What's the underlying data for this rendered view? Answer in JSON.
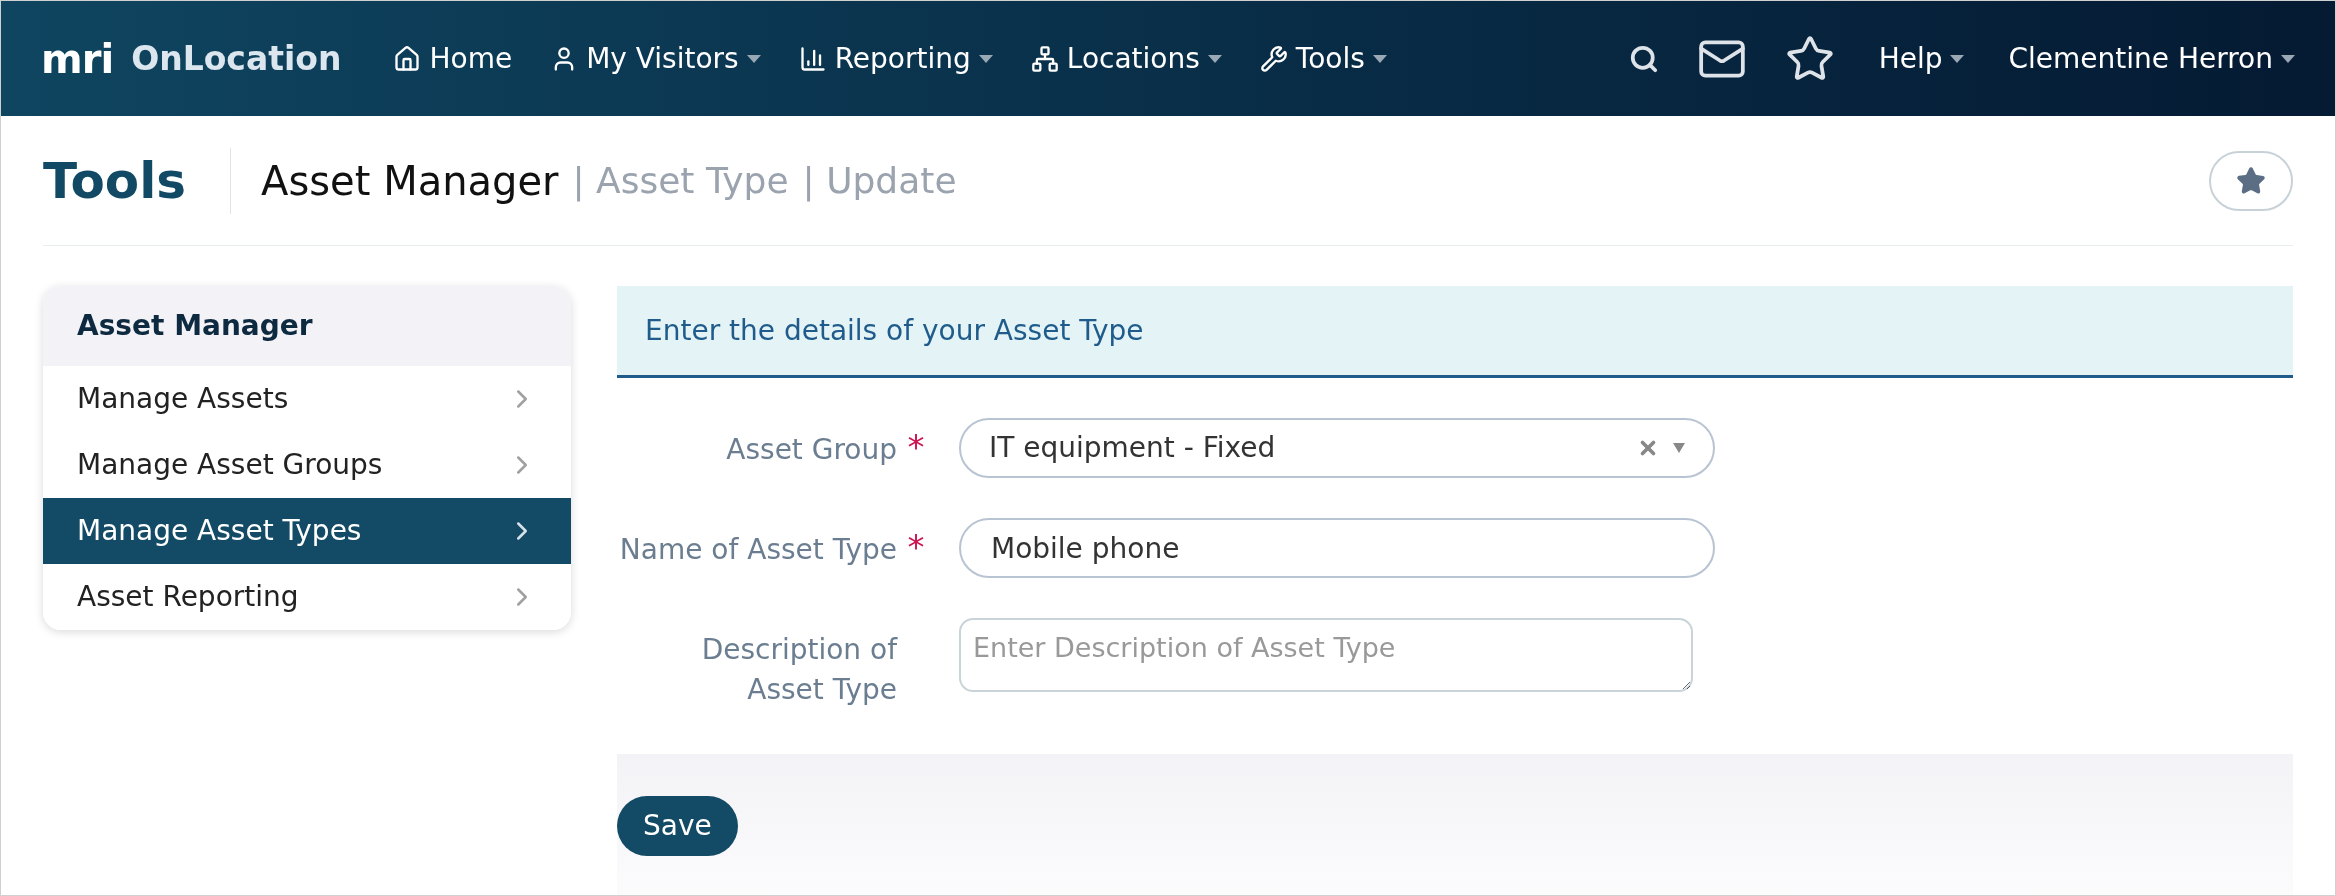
{
  "navbar": {
    "logo": "mri",
    "app_name": "OnLocation",
    "menu": [
      {
        "label": "Home",
        "kind": "home",
        "dropdown": false
      },
      {
        "label": "My Visitors",
        "kind": "user",
        "dropdown": true
      },
      {
        "label": "Reporting",
        "kind": "chart",
        "dropdown": true
      },
      {
        "label": "Locations",
        "kind": "network",
        "dropdown": true
      },
      {
        "label": "Tools",
        "kind": "wrench",
        "dropdown": true
      }
    ],
    "help": "Help",
    "user": "Clementine Herron"
  },
  "page_header": {
    "title": "Tools",
    "section": "Asset Manager",
    "breadcrumbs": [
      "| Asset Type",
      "| Update"
    ]
  },
  "sidebar": {
    "title": "Asset Manager",
    "items": [
      {
        "label": "Manage Assets",
        "selected": false
      },
      {
        "label": "Manage Asset Groups",
        "selected": false
      },
      {
        "label": "Manage Asset Types",
        "selected": true
      },
      {
        "label": "Asset Reporting",
        "selected": false
      }
    ]
  },
  "form": {
    "heading": "Enter the details of your Asset Type",
    "fields": [
      {
        "kind": "select",
        "label": "Asset Group",
        "required": true,
        "value": "IT equipment - Fixed"
      },
      {
        "kind": "text",
        "label": "Name of Asset Type",
        "required": true,
        "value": "Mobile phone"
      },
      {
        "kind": "textarea",
        "label": "Description of Asset Type",
        "required": false,
        "placeholder": "Enter Description of Asset Type"
      }
    ],
    "required_mark": "*",
    "save": "Save"
  }
}
